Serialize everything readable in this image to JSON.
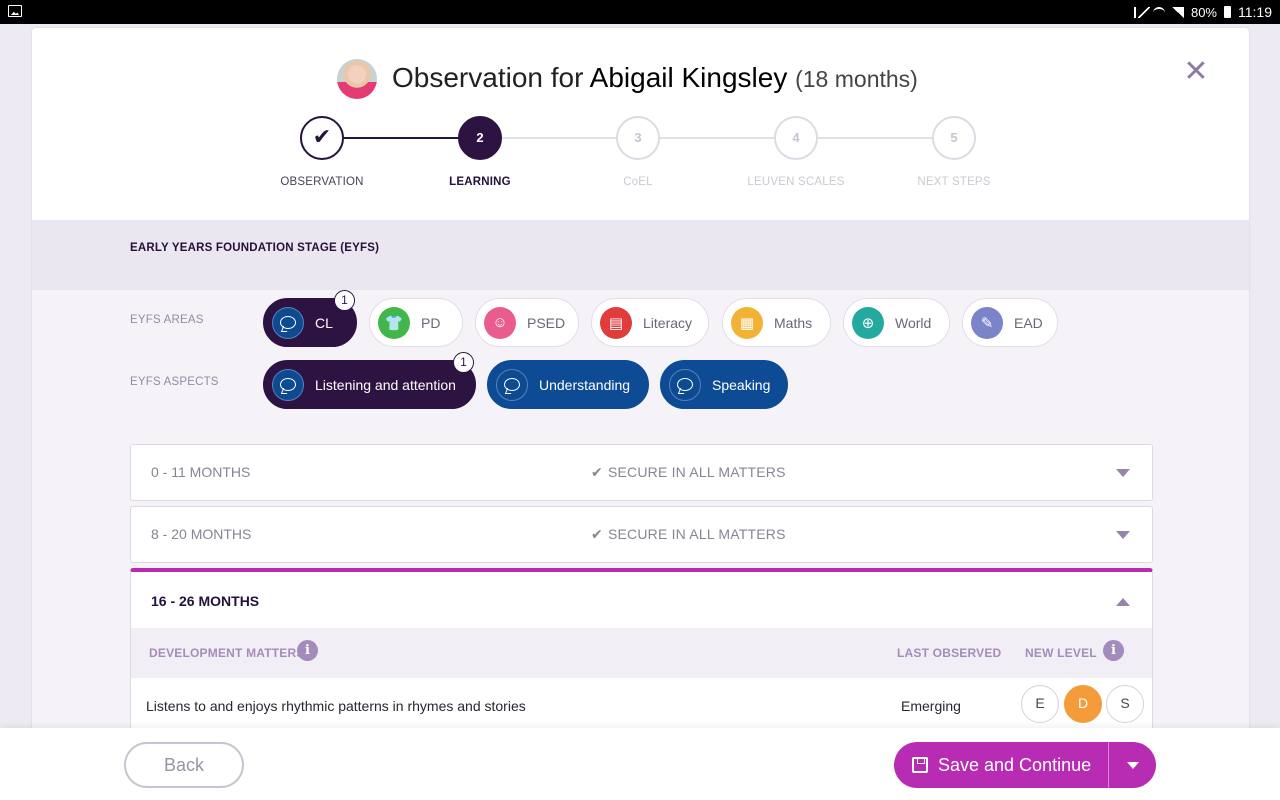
{
  "status_bar": {
    "battery": "80%",
    "time": "11:19",
    "icons": [
      "gallery-icon",
      "mute-icon",
      "wifi-icon",
      "signal-icon",
      "battery-icon"
    ]
  },
  "header": {
    "title_prefix": "Observation for",
    "child_name": "Abigail Kingsley",
    "child_age": "(18 months)",
    "close_icon": "close-icon"
  },
  "stepper": {
    "steps": [
      {
        "number": "✔",
        "label": "OBSERVATION",
        "state": "done"
      },
      {
        "number": "2",
        "label": "LEARNING",
        "state": "active"
      },
      {
        "number": "3",
        "label": "CoEL",
        "state": "pending"
      },
      {
        "number": "4",
        "label": "LEUVEN SCALES",
        "state": "pending"
      },
      {
        "number": "5",
        "label": "NEXT STEPS",
        "state": "pending"
      }
    ]
  },
  "eyfs": {
    "title": "EARLY YEARS FOUNDATION STAGE (EYFS)",
    "areas_label": "EYFS AREAS",
    "aspects_label": "EYFS ASPECTS",
    "areas": [
      {
        "label": "CL",
        "badge": "1",
        "icon": "speech-bubble-icon",
        "color": "#0e4a91",
        "selected": true
      },
      {
        "label": "PD",
        "icon": "tshirt-icon",
        "color": "#43b649"
      },
      {
        "label": "PSED",
        "icon": "smiley-icon",
        "color": "#ea5c8f"
      },
      {
        "label": "Literacy",
        "icon": "book-icon",
        "color": "#e03c3c"
      },
      {
        "label": "Maths",
        "icon": "calculator-icon",
        "color": "#f2b233"
      },
      {
        "label": "World",
        "icon": "globe-icon",
        "color": "#24a9a1"
      },
      {
        "label": "EAD",
        "icon": "paintbrush-icon",
        "color": "#7b83c9"
      }
    ],
    "aspects": [
      {
        "label": "Listening and attention",
        "badge": "1",
        "selected": true
      },
      {
        "label": "Understanding"
      },
      {
        "label": "Speaking"
      }
    ]
  },
  "accordions": [
    {
      "range": "0 - 11 MONTHS",
      "status": "SECURE IN ALL MATTERS",
      "check": "✔"
    },
    {
      "range": "8 - 20 MONTHS",
      "status": "SECURE IN ALL MATTERS",
      "check": "✔"
    }
  ],
  "open_accordion": {
    "range": "16 - 26 MONTHS",
    "col_development": "DEVELOPMENT MATTERS",
    "col_last": "LAST OBSERVED",
    "col_new": "NEW LEVEL",
    "info_glyph": "i",
    "rows": [
      {
        "text": "Listens to and enjoys rhythmic patterns in rhymes and stories",
        "last_observed": "Emerging",
        "levels": [
          "E",
          "D",
          "S"
        ],
        "selected_level": "D"
      }
    ]
  },
  "footer": {
    "back_label": "Back",
    "save_label": "Save and Continue"
  },
  "colors": {
    "primary_dark": "#2d1342",
    "accent_magenta": "#b82cb3",
    "aspect_blue": "#0d4b94",
    "level_selected": "#f59c3a"
  }
}
